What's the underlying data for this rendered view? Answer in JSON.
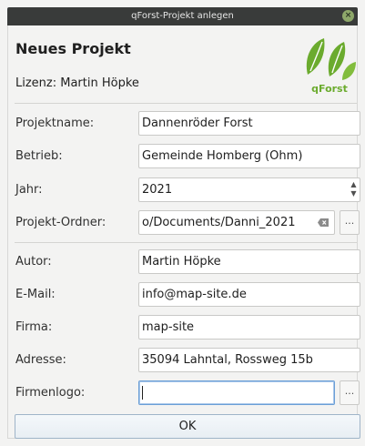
{
  "window": {
    "title": "qForst-Projekt anlegen",
    "close_symbol": "×"
  },
  "header": {
    "heading": "Neues Projekt",
    "license": "Lizenz: Martin Höpke",
    "logo_text": "qForst",
    "logo_color": "#6bab2e"
  },
  "project": {
    "name_label": "Projektname:",
    "name_value": "Dannenröder Forst",
    "company_label": "Betrieb:",
    "company_value": "Gemeinde Homberg (Ohm)",
    "year_label": "Jahr:",
    "year_value": "2021",
    "folder_label": "Projekt-Ordner:",
    "folder_value": "o/Documents/Danni_2021",
    "folder_browse": "..."
  },
  "author": {
    "author_label": "Autor:",
    "author_value": "Martin Höpke",
    "email_label": "E-Mail:",
    "email_value": "info@map-site.de",
    "firm_label": "Firma:",
    "firm_value": "map-site",
    "address_label": "Adresse:",
    "address_value": "35094 Lahntal, Rossweg 15b",
    "logo_label": "Firmenlogo:",
    "logo_value": "",
    "logo_browse": "..."
  },
  "footer": {
    "ok_label": "OK"
  },
  "icons": {
    "close": "close-icon",
    "spin_up": "chevron-up-icon",
    "spin_down": "chevron-down-icon",
    "clear": "backspace-clear-icon",
    "logo": "leaves-logo-icon"
  }
}
